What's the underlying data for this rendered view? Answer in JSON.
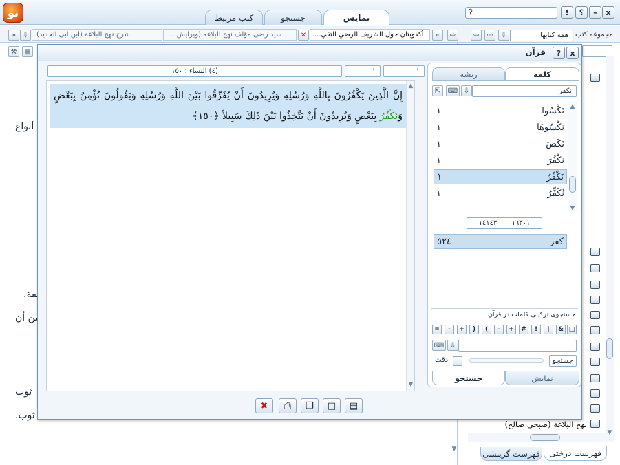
{
  "app": {
    "logo_text": "نو",
    "main_tabs": [
      "نمایش",
      "جستجو",
      "کتب مرتبط"
    ],
    "window_buttons": [
      "!",
      "؟",
      "–",
      "x"
    ]
  },
  "doc_tabs": {
    "active": "أكذوبتان حول الشريف الرضي التقي...",
    "second": "سید رضی مؤلف نهج البلاغه (ویرایش ...",
    "third": "شرح نهج البلاغة (ابن ابی الحدید)"
  },
  "library": {
    "collection_label": "مجموعه کتب",
    "collection_value": "همه کتابها",
    "bottom_item": "نهج البلاغة (صبحی صالح)",
    "bottom_tabs": [
      "فهرست درختی",
      "فهرست گزینشی"
    ]
  },
  "background_text": {
    "fragment_1": "أنواع",
    "fragment_2": "لفة.",
    "fragment_3": "من أن",
    "fragment_4": "ثوب",
    "fragment_5": "ثوب."
  },
  "dialog": {
    "title": "قرآن",
    "nav": {
      "field_a": "١",
      "field_b": "١",
      "surah": "(٤) النساء : ١٥٠"
    },
    "verse": {
      "before": "إِنَّ الَّذِينَ يَكْفُرُونَ بِاللَّهِ وَرُسُلِهِ وَيُرِيدُونَ أَنْ يُفَرِّقُوا بَيْنَ اللَّهِ وَرُسُلِهِ وَيَقُولُونَ نُؤْمِنُ بِبَعْضٍ وَ",
      "highlight": "نَكْفُرُ",
      "after": " بِبَعْضٍ وَيُرِيدُونَ أَنْ يَتَّخِذُوا بَيْنَ ذَلِكَ سَبِيلاً ﴿١٥٠﴾"
    },
    "panel": {
      "tab_word": "کلمه",
      "tab_root": "ریشه",
      "search_value": "نکفر",
      "words": [
        {
          "word": "نَكْسُوا",
          "count": "١"
        },
        {
          "word": "نَكْسُوهَا",
          "count": "١"
        },
        {
          "word": "نَكَصَ",
          "count": "١"
        },
        {
          "word": "نَكْفُرَ",
          "count": "١"
        },
        {
          "word": "نَكْفُرُ",
          "count": "١"
        },
        {
          "word": "نُكَفِّرُ",
          "count": "١"
        }
      ],
      "stat_left": "١٤١٤٣",
      "stat_right": "١٦٣٠١",
      "root_row": {
        "root": "کفر",
        "count": "٥٢٤"
      },
      "combo_title": "جستجوی ترکیبی کلمات در قرآن",
      "operators_row1": [
        "&",
        "|",
        "!",
        "#",
        "+",
        "-",
        "(",
        ")",
        "+",
        "-",
        "="
      ],
      "search_button": "جستجو",
      "precision_label": "دقت",
      "bottom_tab_search": "جستجو",
      "bottom_tab_show": "نمایش"
    }
  }
}
